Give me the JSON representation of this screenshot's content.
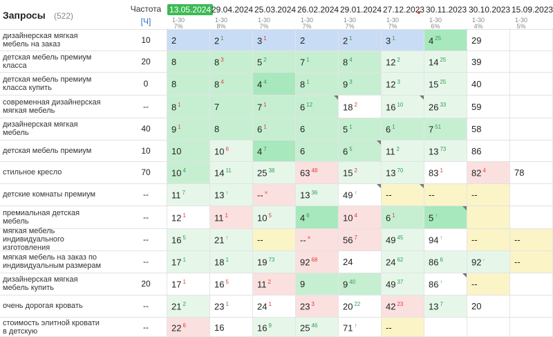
{
  "header": {
    "title": "Запросы",
    "count": "(522)",
    "freq_label": "Частота",
    "freq_sub": "[Ч]"
  },
  "dates": [
    {
      "label": "13.05.2024",
      "range": "1-30",
      "pct": "7%"
    },
    {
      "label": "29.04.2024",
      "range": "1-30",
      "pct": "8%"
    },
    {
      "label": "25.03.2024",
      "range": "1-30",
      "pct": "7%"
    },
    {
      "label": "26.02.2024",
      "range": "1-30",
      "pct": "7%"
    },
    {
      "label": "29.01.2024",
      "range": "1-30",
      "pct": "7%"
    },
    {
      "label": "27.12.2023",
      "range": "1-30",
      "pct": "7%"
    },
    {
      "label": "30.11.2023",
      "range": "1-30",
      "pct": "6%"
    },
    {
      "label": "30.10.2023",
      "range": "1-30",
      "pct": "4%"
    },
    {
      "label": "15.09.2023",
      "range": "1-30",
      "pct": "5%"
    }
  ],
  "colors": {
    "blue": "#c9dcf5",
    "green1": "#e6f7ea",
    "green2": "#c6efd2",
    "green3": "#a8e8bd",
    "red": "#fbe0e0",
    "yellow": "#fbf4c6",
    "white": "#ffffff",
    "active": "#3cba54"
  },
  "rows": [
    {
      "kw": [
        "дизайнерская мягкая",
        "мебель на заказ"
      ],
      "freq": "10",
      "cells": [
        {
          "p": "2",
          "bg": "blue"
        },
        {
          "p": "2",
          "c": "1",
          "d": "up",
          "bg": "blue"
        },
        {
          "p": "3",
          "c": "1",
          "d": "dn",
          "bg": "blue"
        },
        {
          "p": "2",
          "bg": "blue"
        },
        {
          "p": "2",
          "c": "1",
          "d": "up",
          "bg": "blue"
        },
        {
          "p": "3",
          "c": "1",
          "d": "up",
          "bg": "blue"
        },
        {
          "p": "4",
          "c": "25",
          "d": "up",
          "bg": "green3"
        },
        {
          "p": "29",
          "bg": "white"
        },
        {
          "p": "",
          "bg": "white"
        }
      ]
    },
    {
      "kw": [
        "детская мебель премиум",
        "класса"
      ],
      "freq": "20",
      "cells": [
        {
          "p": "8",
          "bg": "green2"
        },
        {
          "p": "8",
          "c": "3",
          "d": "dn",
          "bg": "green2"
        },
        {
          "p": "5",
          "c": "2",
          "d": "up",
          "bg": "green2"
        },
        {
          "p": "7",
          "c": "1",
          "d": "up",
          "bg": "green2"
        },
        {
          "p": "8",
          "c": "4",
          "d": "up",
          "bg": "green2"
        },
        {
          "p": "12",
          "c": "2",
          "d": "up",
          "bg": "green1"
        },
        {
          "p": "14",
          "c": "25",
          "d": "up",
          "bg": "green1"
        },
        {
          "p": "39",
          "bg": "white"
        },
        {
          "p": "",
          "bg": "white"
        }
      ]
    },
    {
      "kw": [
        "детская мебель премиум",
        "класса купить"
      ],
      "freq": "0",
      "cells": [
        {
          "p": "8",
          "bg": "green2"
        },
        {
          "p": "8",
          "c": "4",
          "d": "dn",
          "bg": "green2"
        },
        {
          "p": "4",
          "c": "4",
          "d": "up",
          "bg": "green3"
        },
        {
          "p": "8",
          "c": "1",
          "d": "up",
          "bg": "green2"
        },
        {
          "p": "9",
          "c": "3",
          "d": "up",
          "bg": "green2"
        },
        {
          "p": "12",
          "c": "3",
          "d": "up",
          "bg": "green1"
        },
        {
          "p": "15",
          "c": "25",
          "d": "up",
          "bg": "green1"
        },
        {
          "p": "40",
          "bg": "white"
        },
        {
          "p": "",
          "bg": "white"
        }
      ]
    },
    {
      "kw": [
        "современная дизайнерская",
        "мягкая мебель"
      ],
      "freq": "--",
      "cells": [
        {
          "p": "8",
          "c": "1",
          "d": "dn",
          "bg": "green2"
        },
        {
          "p": "7",
          "bg": "green2"
        },
        {
          "p": "7",
          "c": "1",
          "d": "dn",
          "bg": "green2"
        },
        {
          "p": "6",
          "c": "12",
          "d": "up",
          "bg": "green2",
          "t": true
        },
        {
          "p": "18",
          "c": "2",
          "d": "dn",
          "bg": "white"
        },
        {
          "p": "16",
          "c": "10",
          "d": "up",
          "bg": "green1",
          "t": true
        },
        {
          "p": "26",
          "c": "33",
          "d": "up",
          "bg": "green1"
        },
        {
          "p": "59",
          "bg": "white"
        },
        {
          "p": "",
          "bg": "white"
        }
      ]
    },
    {
      "kw": [
        "дизайнерская мягкая",
        "мебель"
      ],
      "freq": "40",
      "cells": [
        {
          "p": "9",
          "c": "1",
          "d": "dn",
          "bg": "green2"
        },
        {
          "p": "8",
          "bg": "green2"
        },
        {
          "p": "6",
          "c": "1",
          "d": "dn",
          "bg": "green2"
        },
        {
          "p": "6",
          "bg": "green2"
        },
        {
          "p": "5",
          "c": "1",
          "d": "up",
          "bg": "green2"
        },
        {
          "p": "6",
          "c": "1",
          "d": "up",
          "bg": "green2"
        },
        {
          "p": "7",
          "c": "51",
          "d": "up",
          "bg": "green2"
        },
        {
          "p": "58",
          "bg": "white"
        },
        {
          "p": "",
          "bg": "white"
        }
      ]
    },
    {
      "kw": [
        "детская мебель премиум"
      ],
      "freq": "10",
      "cells": [
        {
          "p": "10",
          "bg": "green2"
        },
        {
          "p": "10",
          "c": "6",
          "d": "dn",
          "bg": "green1"
        },
        {
          "p": "4",
          "c": "7",
          "d": "up",
          "bg": "green3"
        },
        {
          "p": "6",
          "bg": "green2"
        },
        {
          "p": "6",
          "c": "5",
          "d": "up",
          "bg": "green2",
          "t": true
        },
        {
          "p": "11",
          "c": "2",
          "d": "up",
          "bg": "green1"
        },
        {
          "p": "13",
          "c": "73",
          "d": "up",
          "bg": "green1"
        },
        {
          "p": "86",
          "bg": "white"
        },
        {
          "p": "",
          "bg": "white"
        }
      ]
    },
    {
      "kw": [
        "стильное кресло"
      ],
      "freq": "70",
      "cells": [
        {
          "p": "10",
          "c": "4",
          "d": "up",
          "bg": "green2"
        },
        {
          "p": "14",
          "c": "11",
          "d": "up",
          "bg": "green1"
        },
        {
          "p": "25",
          "c": "38",
          "d": "up",
          "bg": "green1"
        },
        {
          "p": "63",
          "c": "48",
          "d": "dn",
          "bg": "red"
        },
        {
          "p": "15",
          "c": "2",
          "d": "dn",
          "bg": "green1"
        },
        {
          "p": "13",
          "c": "70",
          "d": "up",
          "bg": "green1"
        },
        {
          "p": "83",
          "c": "1",
          "d": "dn",
          "bg": "white"
        },
        {
          "p": "82",
          "c": "4",
          "d": "dn",
          "bg": "red"
        },
        {
          "p": "78",
          "bg": "white"
        }
      ]
    },
    {
      "kw": [
        "детские комнаты премиум"
      ],
      "freq": "--",
      "cells": [
        {
          "p": "11",
          "c": "7",
          "d": "up",
          "bg": "green1"
        },
        {
          "p": "13",
          "c": "↑",
          "d": "up",
          "bg": "green1"
        },
        {
          "p": "--",
          "c": "×",
          "d": "dn",
          "bg": "red"
        },
        {
          "p": "13",
          "c": "36",
          "d": "up",
          "bg": "green1"
        },
        {
          "p": "49",
          "c": "↑",
          "d": "up",
          "bg": "white",
          "t": true
        },
        {
          "p": "--",
          "bg": "yellow",
          "t": true
        },
        {
          "p": "--",
          "bg": "yellow"
        },
        {
          "p": "--",
          "bg": "yellow"
        },
        {
          "p": "",
          "bg": "white"
        }
      ]
    },
    {
      "kw": [
        "премиальная детская",
        "мебель"
      ],
      "freq": "--",
      "cells": [
        {
          "p": "12",
          "c": "1",
          "d": "dn",
          "bg": "white"
        },
        {
          "p": "11",
          "c": "1",
          "d": "dn",
          "bg": "red"
        },
        {
          "p": "10",
          "c": "5",
          "d": "dn",
          "bg": "green1"
        },
        {
          "p": "4",
          "c": "6",
          "d": "up",
          "bg": "green3"
        },
        {
          "p": "10",
          "c": "4",
          "d": "dn",
          "bg": "red"
        },
        {
          "p": "6",
          "c": "1",
          "d": "dn",
          "bg": "green2"
        },
        {
          "p": "5",
          "c": "↑",
          "d": "up",
          "bg": "green3",
          "t": true
        },
        {
          "p": "",
          "bg": "yellow"
        },
        {
          "p": "",
          "bg": "white"
        }
      ]
    },
    {
      "kw": [
        "мягкая мебель",
        "индивидуального",
        "изготовления"
      ],
      "freq": "--",
      "cells": [
        {
          "p": "16",
          "c": "5",
          "d": "up",
          "bg": "green1"
        },
        {
          "p": "21",
          "c": "↑",
          "d": "up",
          "bg": "green1"
        },
        {
          "p": "--",
          "bg": "yellow"
        },
        {
          "p": "--",
          "c": "×",
          "d": "dn",
          "bg": "red"
        },
        {
          "p": "56",
          "c": "7",
          "d": "dn",
          "bg": "red"
        },
        {
          "p": "49",
          "c": "45",
          "d": "up",
          "bg": "green1"
        },
        {
          "p": "94",
          "c": "↑",
          "d": "up",
          "bg": "white"
        },
        {
          "p": "--",
          "bg": "yellow"
        },
        {
          "p": "--",
          "bg": "yellow"
        }
      ]
    },
    {
      "kw": [
        "мягкая мебель на заказ по",
        "индивидуальным размерам"
      ],
      "freq": "--",
      "cells": [
        {
          "p": "17",
          "c": "1",
          "d": "up",
          "bg": "green1"
        },
        {
          "p": "18",
          "c": "1",
          "d": "up",
          "bg": "green1"
        },
        {
          "p": "19",
          "c": "73",
          "d": "up",
          "bg": "green1"
        },
        {
          "p": "92",
          "c": "68",
          "d": "dn",
          "bg": "red"
        },
        {
          "p": "24",
          "bg": "white"
        },
        {
          "p": "24",
          "c": "62",
          "d": "up",
          "bg": "green1"
        },
        {
          "p": "86",
          "c": "6",
          "d": "up",
          "bg": "green1"
        },
        {
          "p": "92",
          "c": "-",
          "d": "up",
          "bg": "green1"
        },
        {
          "p": "--",
          "bg": "yellow"
        }
      ]
    },
    {
      "kw": [
        "дизайнерская мягкая",
        "мебель купить"
      ],
      "freq": "20",
      "cells": [
        {
          "p": "17",
          "c": "1",
          "d": "dn",
          "bg": "white"
        },
        {
          "p": "16",
          "c": "5",
          "d": "dn",
          "bg": "white"
        },
        {
          "p": "11",
          "c": "2",
          "d": "dn",
          "bg": "red"
        },
        {
          "p": "9",
          "bg": "green2"
        },
        {
          "p": "9",
          "c": "40",
          "d": "up",
          "bg": "green2"
        },
        {
          "p": "49",
          "c": "37",
          "d": "up",
          "bg": "green1"
        },
        {
          "p": "86",
          "c": "↑",
          "d": "up",
          "bg": "white",
          "t": true
        },
        {
          "p": "--",
          "bg": "yellow"
        },
        {
          "p": "",
          "bg": "white"
        }
      ]
    },
    {
      "kw": [
        "очень дорогая кровать"
      ],
      "freq": "--",
      "cells": [
        {
          "p": "21",
          "c": "2",
          "d": "up",
          "bg": "green1"
        },
        {
          "p": "23",
          "c": "1",
          "d": "up",
          "bg": "white"
        },
        {
          "p": "24",
          "c": "1",
          "d": "dn",
          "bg": "white"
        },
        {
          "p": "23",
          "c": "3",
          "d": "dn",
          "bg": "red"
        },
        {
          "p": "20",
          "c": "22",
          "d": "up",
          "bg": "white"
        },
        {
          "p": "42",
          "c": "23",
          "d": "dn",
          "bg": "red"
        },
        {
          "p": "13",
          "c": "7",
          "d": "up",
          "bg": "green1"
        },
        {
          "p": "20",
          "bg": "white"
        },
        {
          "p": "",
          "bg": "white"
        }
      ]
    },
    {
      "kw": [
        "стоимость элитной кровати",
        "в детскую"
      ],
      "freq": "--",
      "cells": [
        {
          "p": "22",
          "c": "6",
          "d": "dn",
          "bg": "red"
        },
        {
          "p": "16",
          "bg": "white"
        },
        {
          "p": "16",
          "c": "9",
          "d": "up",
          "bg": "green1"
        },
        {
          "p": "25",
          "c": "46",
          "d": "up",
          "bg": "green1"
        },
        {
          "p": "71",
          "c": "↑",
          "d": "up",
          "bg": "white"
        },
        {
          "p": "--",
          "bg": "yellow"
        },
        {
          "p": "",
          "bg": "white"
        },
        {
          "p": "",
          "bg": "white"
        },
        {
          "p": "",
          "bg": "white"
        }
      ]
    }
  ]
}
